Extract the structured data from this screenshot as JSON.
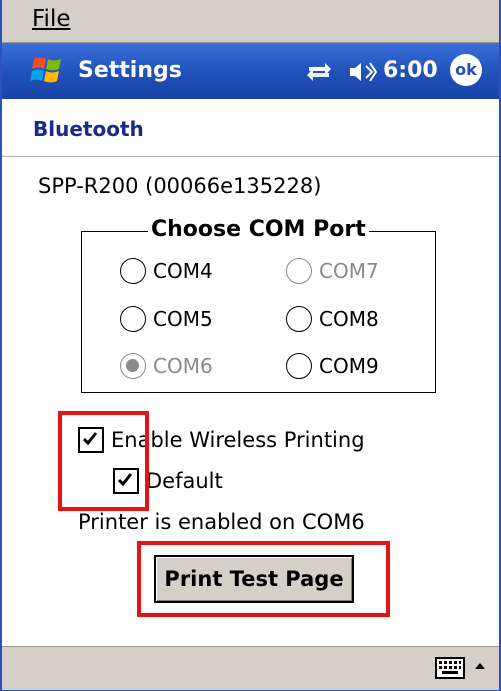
{
  "menubar": {
    "file_label": "File"
  },
  "titlebar": {
    "title": "Settings",
    "clock": "6:00",
    "ok_label": "ok",
    "icons": [
      "windows-start-icon",
      "connectivity-icon",
      "volume-icon"
    ]
  },
  "page": {
    "header": "Bluetooth",
    "device": "SPP-R200 (00066e135228)"
  },
  "com_port": {
    "legend": "Choose COM Port",
    "options": [
      {
        "label": "COM4",
        "selected": false,
        "enabled": true
      },
      {
        "label": "COM7",
        "selected": false,
        "enabled": false
      },
      {
        "label": "COM5",
        "selected": false,
        "enabled": true
      },
      {
        "label": "COM8",
        "selected": false,
        "enabled": true
      },
      {
        "label": "COM6",
        "selected": true,
        "enabled": false
      },
      {
        "label": "COM9",
        "selected": false,
        "enabled": true
      }
    ]
  },
  "options": {
    "enable_wireless_printing": {
      "label": "Enable Wireless Printing",
      "checked": true
    },
    "default": {
      "label": "Default",
      "checked": true
    }
  },
  "status": "Printer is enabled on COM6",
  "print_button": "Print Test Page",
  "colors": {
    "title_bar": "#1f4fb8",
    "highlight": "#e51414",
    "header_text": "#1a2a8c",
    "chrome": "#d4d0c8"
  }
}
